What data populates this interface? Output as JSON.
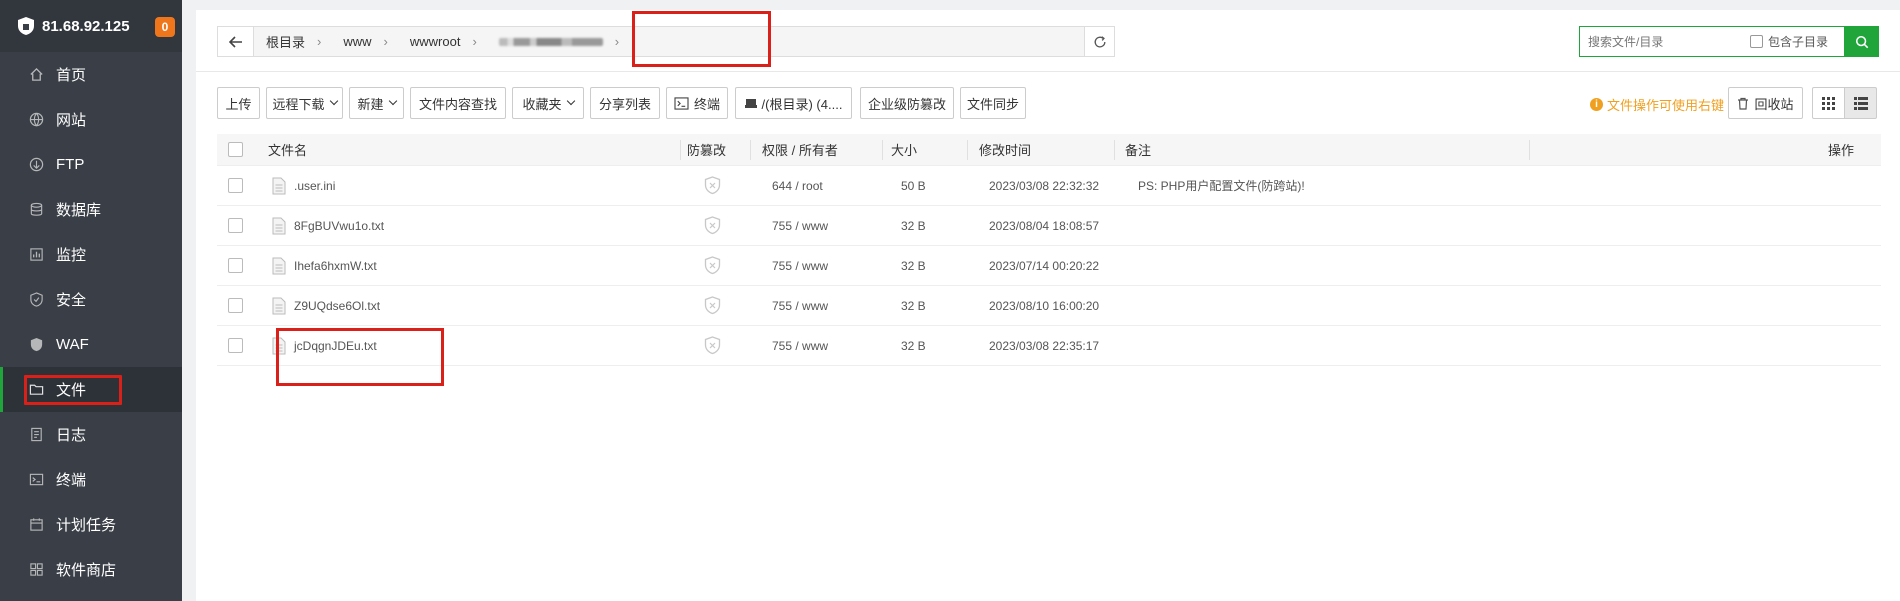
{
  "sidebar": {
    "ip": "81.68.92.125",
    "badge": "0",
    "items": [
      {
        "label": "首页",
        "icon": "home-icon"
      },
      {
        "label": "网站",
        "icon": "globe-icon"
      },
      {
        "label": "FTP",
        "icon": "ftp-icon"
      },
      {
        "label": "数据库",
        "icon": "database-icon"
      },
      {
        "label": "监控",
        "icon": "monitor-icon"
      },
      {
        "label": "安全",
        "icon": "shield-icon"
      },
      {
        "label": "WAF",
        "icon": "waf-icon"
      },
      {
        "label": "文件",
        "icon": "folder-icon",
        "active": true
      },
      {
        "label": "日志",
        "icon": "log-icon"
      },
      {
        "label": "终端",
        "icon": "terminal-icon"
      },
      {
        "label": "计划任务",
        "icon": "calendar-icon"
      },
      {
        "label": "软件商店",
        "icon": "apps-icon"
      }
    ]
  },
  "path": {
    "crumbs": [
      "根目录",
      "www",
      "wwwroot"
    ]
  },
  "search": {
    "placeholder": "搜索文件/目录",
    "include_sub": "包含子目录"
  },
  "toolbar": {
    "upload": "上传",
    "remote_download": "远程下载",
    "new": "新建",
    "content_search": "文件内容查找",
    "favorites": "收藏夹",
    "share_list": "分享列表",
    "terminal": "终端",
    "disk": "/(根目录) (4....",
    "tamper": "企业级防篡改",
    "sync": "文件同步",
    "hint": "文件操作可使用右键",
    "recycle": "回收站"
  },
  "table": {
    "headers": {
      "name": "文件名",
      "tamper": "防篡改",
      "perm": "权限 / 所有者",
      "size": "大小",
      "mtime": "修改时间",
      "note": "备注",
      "ops": "操作"
    },
    "rows": [
      {
        "name": ".user.ini",
        "perm": "644 / root",
        "size": "50 B",
        "mtime": "2023/03/08 22:32:32",
        "note": "PS: PHP用户配置文件(防跨站)!"
      },
      {
        "name": "8FgBUVwu1o.txt",
        "perm": "755 / www",
        "size": "32 B",
        "mtime": "2023/08/04 18:08:57",
        "note": ""
      },
      {
        "name": "Ihefa6hxmW.txt",
        "perm": "755 / www",
        "size": "32 B",
        "mtime": "2023/07/14 00:20:22",
        "note": ""
      },
      {
        "name": "Z9UQdse6Ol.txt",
        "perm": "755 / www",
        "size": "32 B",
        "mtime": "2023/08/10 16:00:20",
        "note": ""
      },
      {
        "name": "jcDqgnJDEu.txt",
        "perm": "755 / www",
        "size": "32 B",
        "mtime": "2023/03/08 22:35:17",
        "note": ""
      }
    ]
  },
  "colors": {
    "accent": "#20a53a",
    "sidebar_bg": "#3a3f47",
    "highlight": "#d9211a",
    "hint": "#f0a020"
  }
}
